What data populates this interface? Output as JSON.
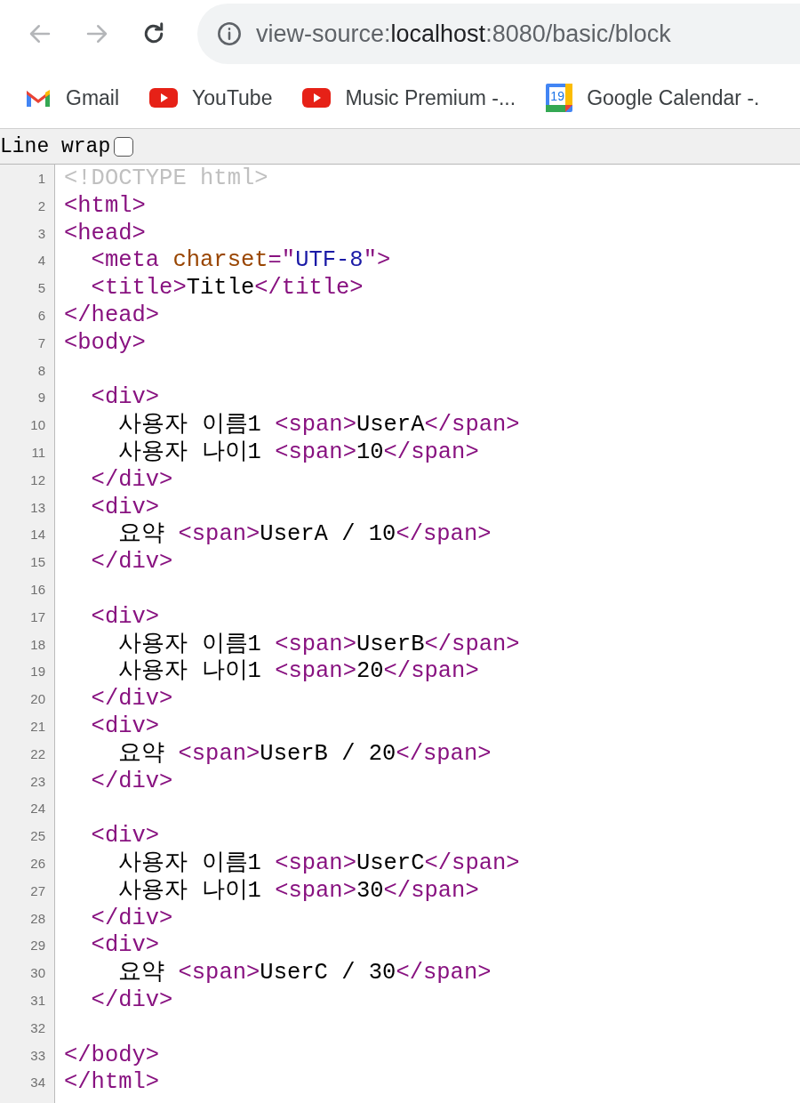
{
  "toolbar": {
    "back": {
      "disabled": true
    },
    "forward": {
      "disabled": true
    },
    "address": [
      {
        "text": "view-source:",
        "emphasis": false
      },
      {
        "text": "localhost",
        "emphasis": true
      },
      {
        "text": ":8080/basic/block",
        "emphasis": false
      }
    ]
  },
  "bookmarks": [
    {
      "label": "Gmail",
      "kind": "mail"
    },
    {
      "label": "YouTube",
      "kind": "video"
    },
    {
      "label": "Music Premium -...",
      "kind": "video"
    },
    {
      "label": "Google Calendar -.",
      "kind": "calendar",
      "badge": "19"
    }
  ],
  "line_wrap": {
    "label": "Line wrap",
    "checked": false
  },
  "source_lines": [
    {
      "number": "1",
      "tokens": [
        {
          "kind": "comment",
          "text": "<!DOCTYPE html>"
        }
      ]
    },
    {
      "number": "2",
      "tokens": [
        {
          "kind": "tag",
          "text": "<html>"
        }
      ]
    },
    {
      "number": "3",
      "tokens": [
        {
          "kind": "tag",
          "text": "<head>"
        }
      ]
    },
    {
      "number": "4",
      "tokens": [
        {
          "kind": "tag",
          "text": "  <meta "
        },
        {
          "kind": "attr",
          "text": "charset"
        },
        {
          "kind": "tag",
          "text": "=\""
        },
        {
          "kind": "value",
          "text": "UTF-8"
        },
        {
          "kind": "tag",
          "text": "\">"
        }
      ]
    },
    {
      "number": "5",
      "tokens": [
        {
          "kind": "tag",
          "text": "  <title>"
        },
        {
          "kind": "text",
          "text": "Title"
        },
        {
          "kind": "tag",
          "text": "</title>"
        }
      ]
    },
    {
      "number": "6",
      "tokens": [
        {
          "kind": "tag",
          "text": "</head>"
        }
      ]
    },
    {
      "number": "7",
      "tokens": [
        {
          "kind": "tag",
          "text": "<body>"
        }
      ]
    },
    {
      "number": "8"
    },
    {
      "number": "9",
      "tokens": [
        {
          "kind": "tag",
          "text": "  <div>"
        }
      ]
    },
    {
      "number": "10",
      "tokens": [
        {
          "kind": "text",
          "text": "    사용자 이름1 "
        },
        {
          "kind": "tag",
          "text": "<span>"
        },
        {
          "kind": "text",
          "text": "UserA"
        },
        {
          "kind": "tag",
          "text": "</span>"
        }
      ]
    },
    {
      "number": "11",
      "tokens": [
        {
          "kind": "text",
          "text": "    사용자 나이1 "
        },
        {
          "kind": "tag",
          "text": "<span>"
        },
        {
          "kind": "text",
          "text": "10"
        },
        {
          "kind": "tag",
          "text": "</span>"
        }
      ]
    },
    {
      "number": "12",
      "tokens": [
        {
          "kind": "tag",
          "text": "  </div>"
        }
      ]
    },
    {
      "number": "13",
      "tokens": [
        {
          "kind": "tag",
          "text": "  <div>"
        }
      ]
    },
    {
      "number": "14",
      "tokens": [
        {
          "kind": "text",
          "text": "    요약 "
        },
        {
          "kind": "tag",
          "text": "<span>"
        },
        {
          "kind": "text",
          "text": "UserA / 10"
        },
        {
          "kind": "tag",
          "text": "</span>"
        }
      ]
    },
    {
      "number": "15",
      "tokens": [
        {
          "kind": "tag",
          "text": "  </div>"
        }
      ]
    },
    {
      "number": "16"
    },
    {
      "number": "17",
      "tokens": [
        {
          "kind": "tag",
          "text": "  <div>"
        }
      ]
    },
    {
      "number": "18",
      "tokens": [
        {
          "kind": "text",
          "text": "    사용자 이름1 "
        },
        {
          "kind": "tag",
          "text": "<span>"
        },
        {
          "kind": "text",
          "text": "UserB"
        },
        {
          "kind": "tag",
          "text": "</span>"
        }
      ]
    },
    {
      "number": "19",
      "tokens": [
        {
          "kind": "text",
          "text": "    사용자 나이1 "
        },
        {
          "kind": "tag",
          "text": "<span>"
        },
        {
          "kind": "text",
          "text": "20"
        },
        {
          "kind": "tag",
          "text": "</span>"
        }
      ]
    },
    {
      "number": "20",
      "tokens": [
        {
          "kind": "tag",
          "text": "  </div>"
        }
      ]
    },
    {
      "number": "21",
      "tokens": [
        {
          "kind": "tag",
          "text": "  <div>"
        }
      ]
    },
    {
      "number": "22",
      "tokens": [
        {
          "kind": "text",
          "text": "    요약 "
        },
        {
          "kind": "tag",
          "text": "<span>"
        },
        {
          "kind": "text",
          "text": "UserB / 20"
        },
        {
          "kind": "tag",
          "text": "</span>"
        }
      ]
    },
    {
      "number": "23",
      "tokens": [
        {
          "kind": "tag",
          "text": "  </div>"
        }
      ]
    },
    {
      "number": "24"
    },
    {
      "number": "25",
      "tokens": [
        {
          "kind": "tag",
          "text": "  <div>"
        }
      ]
    },
    {
      "number": "26",
      "tokens": [
        {
          "kind": "text",
          "text": "    사용자 이름1 "
        },
        {
          "kind": "tag",
          "text": "<span>"
        },
        {
          "kind": "text",
          "text": "UserC"
        },
        {
          "kind": "tag",
          "text": "</span>"
        }
      ]
    },
    {
      "number": "27",
      "tokens": [
        {
          "kind": "text",
          "text": "    사용자 나이1 "
        },
        {
          "kind": "tag",
          "text": "<span>"
        },
        {
          "kind": "text",
          "text": "30"
        },
        {
          "kind": "tag",
          "text": "</span>"
        }
      ]
    },
    {
      "number": "28",
      "tokens": [
        {
          "kind": "tag",
          "text": "  </div>"
        }
      ]
    },
    {
      "number": "29",
      "tokens": [
        {
          "kind": "tag",
          "text": "  <div>"
        }
      ]
    },
    {
      "number": "30",
      "tokens": [
        {
          "kind": "text",
          "text": "    요약 "
        },
        {
          "kind": "tag",
          "text": "<span>"
        },
        {
          "kind": "text",
          "text": "UserC / 30"
        },
        {
          "kind": "tag",
          "text": "</span>"
        }
      ]
    },
    {
      "number": "31",
      "tokens": [
        {
          "kind": "tag",
          "text": "  </div>"
        }
      ]
    },
    {
      "number": "32"
    },
    {
      "number": "33",
      "tokens": [
        {
          "kind": "tag",
          "text": "</body>"
        }
      ]
    },
    {
      "number": "34",
      "tokens": [
        {
          "kind": "tag",
          "text": "</html>"
        }
      ]
    }
  ]
}
